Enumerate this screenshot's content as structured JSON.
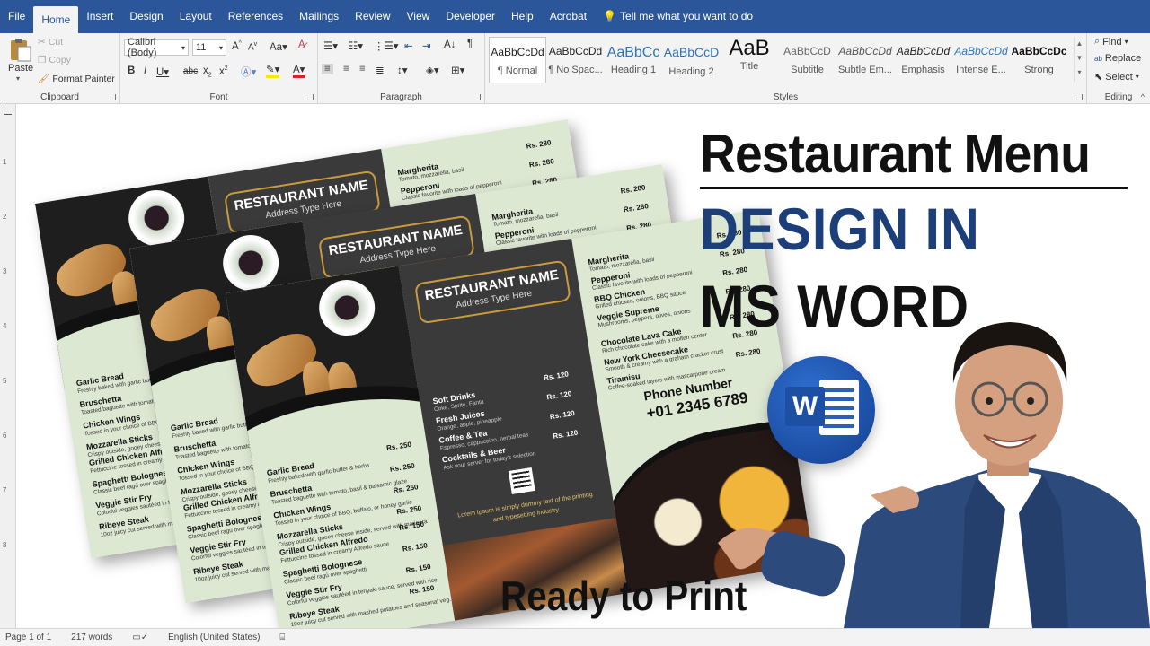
{
  "tabs": [
    "File",
    "Home",
    "Insert",
    "Design",
    "Layout",
    "References",
    "Mailings",
    "Review",
    "View",
    "Developer",
    "Help",
    "Acrobat"
  ],
  "active_tab": "Home",
  "tell_me": "Tell me what you want to do",
  "clipboard": {
    "paste": "Paste",
    "cut": "Cut",
    "copy": "Copy",
    "format_painter": "Format Painter",
    "label": "Clipboard"
  },
  "font": {
    "name": "Calibri (Body)",
    "size": "11",
    "label": "Font"
  },
  "paragraph": {
    "label": "Paragraph"
  },
  "styles": {
    "label": "Styles",
    "items": [
      {
        "preview": "AaBbCcDd",
        "name": "¶ Normal"
      },
      {
        "preview": "AaBbCcDd",
        "name": "¶ No Spac..."
      },
      {
        "preview": "AaBbCc",
        "name": "Heading 1"
      },
      {
        "preview": "AaBbCcD",
        "name": "Heading 2"
      },
      {
        "preview": "AaB",
        "name": "Title"
      },
      {
        "preview": "AaBbCcD",
        "name": "Subtitle"
      },
      {
        "preview": "AaBbCcDd",
        "name": "Subtle Em..."
      },
      {
        "preview": "AaBbCcDd",
        "name": "Emphasis"
      },
      {
        "preview": "AaBbCcDd",
        "name": "Intense E..."
      },
      {
        "preview": "AaBbCcDc",
        "name": "Strong"
      }
    ]
  },
  "editing": {
    "find": "Find",
    "replace": "Replace",
    "select": "Select",
    "label": "Editing"
  },
  "ruler_numbers": [
    "1",
    "2",
    "3",
    "4",
    "5",
    "6",
    "7",
    "8"
  ],
  "status": {
    "page": "Page 1 of 1",
    "words": "217 words",
    "language": "English (United States)"
  },
  "headline": {
    "line1": "Restaurant Menu",
    "line2": "DESIGN IN",
    "line3": "MS WORD",
    "ready": "Ready to Print"
  },
  "menu": {
    "name": "RESTAURANT NAME",
    "address": "Address Type Here",
    "left_items": [
      {
        "name": "Garlic Bread",
        "desc": "Freshly baked with garlic butter & herbs",
        "price": "Rs. 250"
      },
      {
        "name": "Bruschetta",
        "desc": "Toasted baguette with tomato, basil & balsamic glaze",
        "price": "Rs. 250"
      },
      {
        "name": "Chicken Wings",
        "desc": "Tossed in your choice of BBQ, buffalo, or honey garlic",
        "price": "Rs. 250"
      },
      {
        "name": "Mozzarella Sticks",
        "desc": "Crispy outside, gooey cheese inside, served with marinara",
        "price": "Rs. 250"
      },
      {
        "name": "Grilled Chicken Alfredo",
        "desc": "Fettuccine tossed in creamy Alfredo sauce",
        "price": "Rs. 150"
      },
      {
        "name": "Spaghetti Bolognese",
        "desc": "Classic beef ragù over spaghetti",
        "price": "Rs. 150"
      },
      {
        "name": "Veggie Stir Fry",
        "desc": "Colorful veggies sautéed in teriyaki sauce, served with rice",
        "price": "Rs. 150"
      },
      {
        "name": "Ribeye Steak",
        "desc": "10oz juicy cut served with mashed potatoes and seasonal veg.",
        "price": "Rs. 150"
      }
    ],
    "mid_items": [
      {
        "name": "Soft Drinks",
        "desc": "Coke, Sprite, Fanta",
        "price": "Rs. 120"
      },
      {
        "name": "Fresh Juices",
        "desc": "Orange, apple, pineapple",
        "price": "Rs. 120"
      },
      {
        "name": "Coffee & Tea",
        "desc": "Espresso, cappuccino, herbal teas",
        "price": "Rs. 120"
      },
      {
        "name": "Cocktails & Beer",
        "desc": "Ask your server for today's selection",
        "price": "Rs. 120"
      }
    ],
    "lorem": "Lorem Ipsum is simply dummy text of the printing and typesetting industry.",
    "right_items": [
      {
        "name": "Margherita",
        "desc": "Tomato, mozzarella, basil",
        "price": "Rs. 280"
      },
      {
        "name": "Pepperoni",
        "desc": "Classic favorite with loads of pepperoni",
        "price": "Rs. 280"
      },
      {
        "name": "BBQ Chicken",
        "desc": "Grilled chicken, onions, BBQ sauce",
        "price": "Rs. 280"
      },
      {
        "name": "Veggie Supreme",
        "desc": "Mushrooms, peppers, olives, onions",
        "price": "Rs. 280"
      },
      {
        "name": "Chocolate Lava Cake",
        "desc": "Rich chocolate cake with a molten center",
        "price": "Rs. 280"
      },
      {
        "name": "New York Cheesecake",
        "desc": "Smooth & creamy with a graham cracker crust",
        "price": "Rs. 280"
      },
      {
        "name": "Tiramisu",
        "desc": "Coffee-soaked layers with mascarpone cream",
        "price": "Rs. 280"
      }
    ],
    "phone_label": "Phone Number",
    "phone_number": "+01 2345 6789"
  },
  "colors": {
    "ribbon_blue": "#2b579a",
    "headline_blue": "#1c3f7a",
    "menu_green": "#dde8d3",
    "menu_dark": "#3a3a3a",
    "menu_gold": "#c89b3c"
  }
}
